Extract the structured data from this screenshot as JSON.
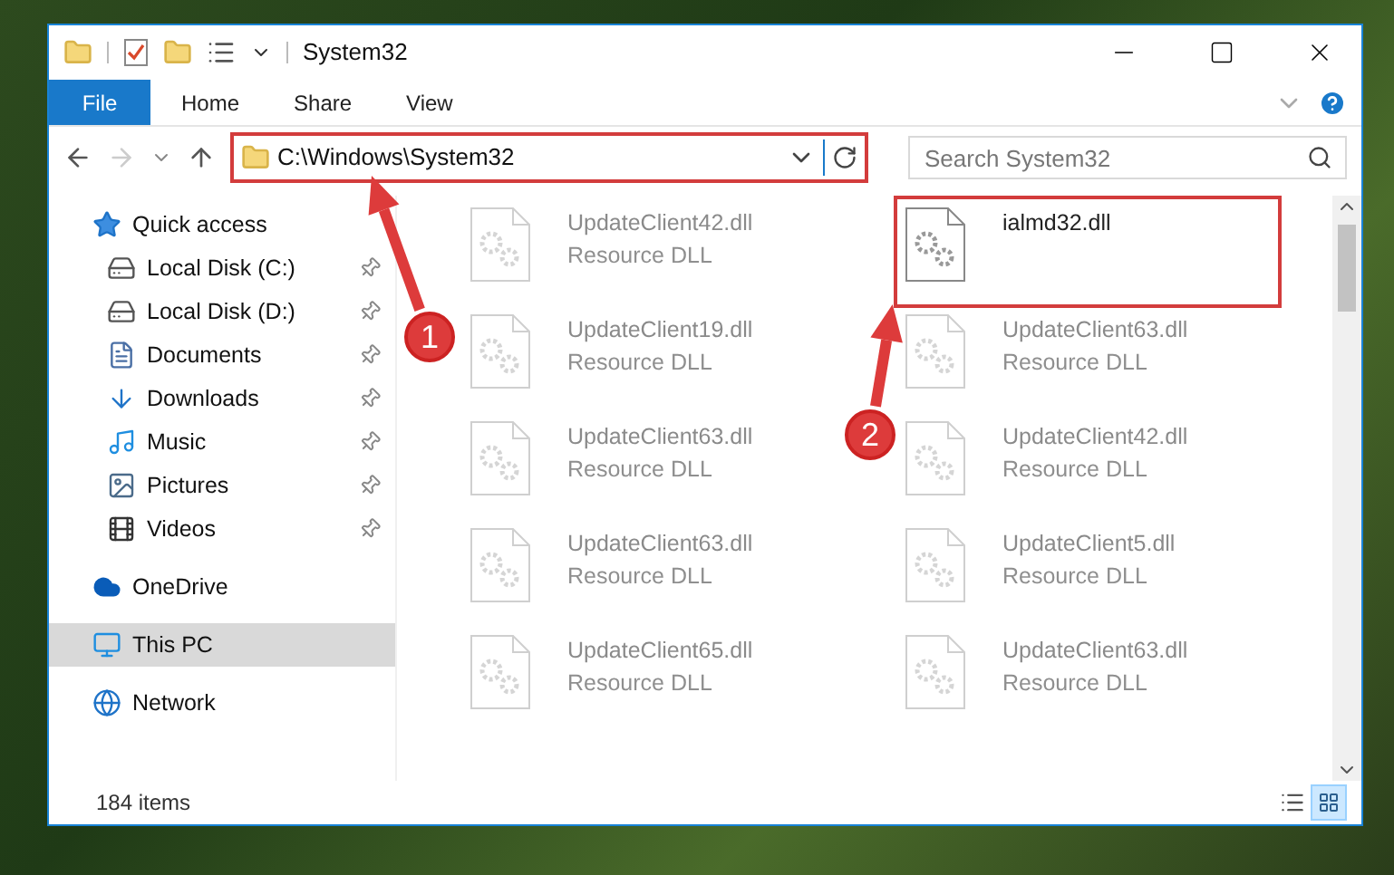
{
  "window": {
    "title": "System32"
  },
  "ribbon_tabs": [
    {
      "label": "File",
      "kind": "file"
    },
    {
      "label": "Home",
      "kind": "tab"
    },
    {
      "label": "Share",
      "kind": "tab"
    },
    {
      "label": "View",
      "kind": "tab"
    }
  ],
  "address_bar": {
    "path": "C:\\Windows\\System32",
    "highlighted": true
  },
  "search": {
    "placeholder": "Search System32"
  },
  "sidebar": {
    "items": [
      {
        "label": "Quick access",
        "selected": false,
        "children": [
          {
            "label": "Local Disk (C:)",
            "selected": false
          },
          {
            "label": "Local Disk (D:)",
            "selected": false
          },
          {
            "label": "Documents",
            "selected": false
          },
          {
            "label": "Downloads",
            "selected": false
          },
          {
            "label": "Music",
            "selected": false
          },
          {
            "label": "Pictures",
            "selected": false
          },
          {
            "label": "Videos",
            "selected": false
          }
        ]
      },
      {
        "label": "OneDrive",
        "selected": false
      },
      {
        "label": "This PC",
        "selected": true
      },
      {
        "label": "Network",
        "selected": false
      }
    ]
  },
  "files": [
    {
      "name": "UpdateClient42.dll",
      "type": "Resource DLL",
      "highlighted": false
    },
    {
      "name": "ialmd32.dll",
      "highlighted": true
    },
    {
      "name": "UpdateClient19.dll",
      "type": "Resource DLL",
      "highlighted": false
    },
    {
      "name": "UpdateClient63.dll",
      "type": "Resource DLL",
      "highlighted": false
    },
    {
      "name": "UpdateClient63.dll",
      "type": "Resource DLL",
      "highlighted": false
    },
    {
      "name": "UpdateClient42.dll",
      "type": "Resource DLL",
      "highlighted": false
    },
    {
      "name": "UpdateClient63.dll",
      "type": "Resource DLL",
      "highlighted": false
    },
    {
      "name": "UpdateClient5.dll",
      "type": "Resource DLL",
      "highlighted": false
    },
    {
      "name": "UpdateClient65.dll",
      "type": "Resource DLL",
      "highlighted": false
    },
    {
      "name": "UpdateClient63.dll",
      "type": "Resource DLL",
      "highlighted": false
    }
  ],
  "status_bar": {
    "count": "184 items",
    "view_modes": [
      {
        "kind": "details",
        "selected": false
      },
      {
        "kind": "large-icons",
        "selected": true
      }
    ]
  },
  "annotations": [
    {
      "label": "1"
    },
    {
      "label": "2"
    }
  ]
}
